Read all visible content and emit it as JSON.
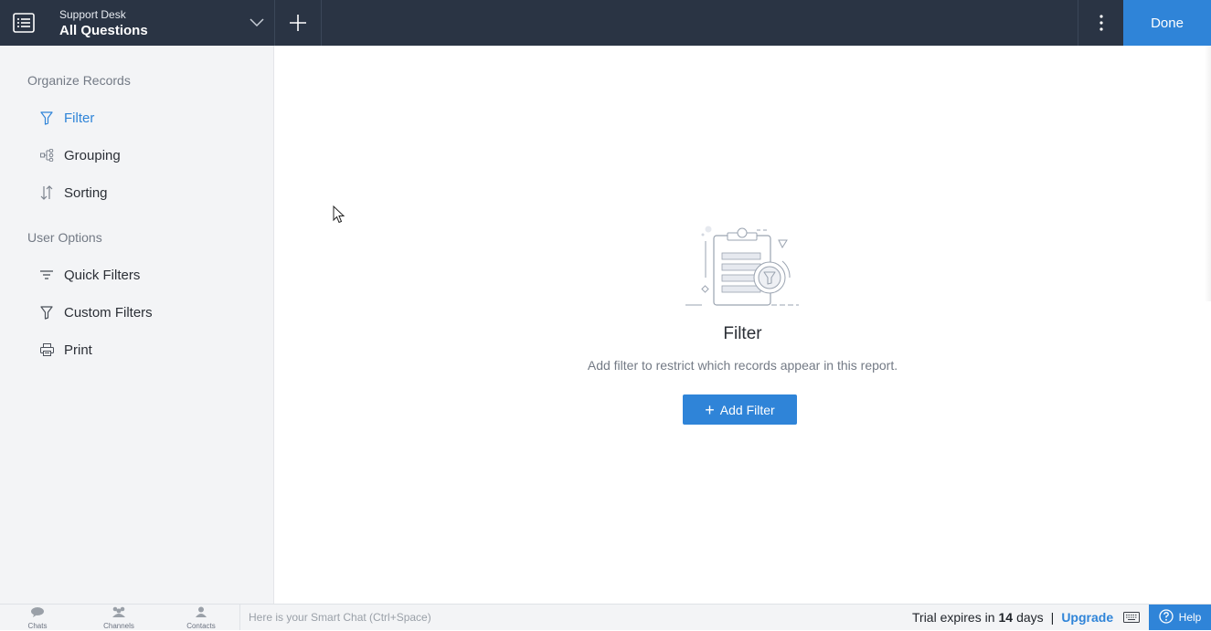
{
  "header": {
    "app_name": "Support Desk",
    "view_name": "All Questions",
    "done_label": "Done"
  },
  "sidebar": {
    "organize_title": "Organize Records",
    "organize_items": [
      {
        "label": "Filter",
        "icon": "funnel-icon",
        "active": true
      },
      {
        "label": "Grouping",
        "icon": "grouping-icon",
        "active": false
      },
      {
        "label": "Sorting",
        "icon": "sort-icon",
        "active": false
      }
    ],
    "user_title": "User Options",
    "user_items": [
      {
        "label": "Quick Filters",
        "icon": "quick-filter-icon"
      },
      {
        "label": "Custom Filters",
        "icon": "funnel-icon"
      },
      {
        "label": "Print",
        "icon": "printer-icon"
      }
    ]
  },
  "main": {
    "empty_title": "Filter",
    "empty_desc": "Add filter to restrict which records appear in this report.",
    "add_filter_label": "Add Filter"
  },
  "bottombar": {
    "tabs": [
      {
        "label": "Chats",
        "icon": "chat-icon"
      },
      {
        "label": "Channels",
        "icon": "channels-icon"
      },
      {
        "label": "Contacts",
        "icon": "contact-icon"
      }
    ],
    "smart_chat_placeholder": "Here is your Smart Chat (Ctrl+Space)",
    "trial_prefix": "Trial expires in",
    "trial_days": "14",
    "trial_suffix": "days",
    "pipe": "|",
    "upgrade_label": "Upgrade",
    "help_label": "Help"
  },
  "colors": {
    "topbar": "#2a3444",
    "accent": "#2f84d8",
    "sidebar_bg": "#f3f4f6"
  }
}
